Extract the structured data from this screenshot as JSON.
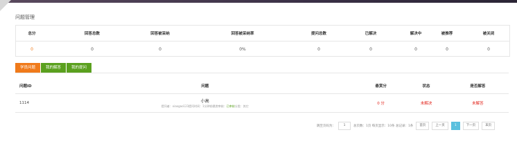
{
  "section_title": "问题管理",
  "stats": {
    "headers": [
      "总分",
      "回答总数",
      "回答被采纳",
      "回答被采纳率",
      "提问总数",
      "已解决",
      "解决中",
      "被推荐",
      "被关闭"
    ],
    "values": [
      "0",
      "0",
      "0",
      "0%",
      "0",
      "0",
      "0",
      "0",
      "0"
    ]
  },
  "tabs": [
    {
      "label": "学员问题",
      "active": true
    },
    {
      "label": "我的解答",
      "active": false
    },
    {
      "label": "我的提问",
      "active": false
    }
  ],
  "table": {
    "headers": {
      "id": "问题ID",
      "title": "问题",
      "reward": "悬赏分",
      "status": "状态",
      "accepted": "是否解答"
    },
    "rows": [
      {
        "id": "1114",
        "title": "小高",
        "meta_prefix": "提问者：xiaogao123提问时间：1分钟前悬赏审核：",
        "meta_status": "已审核",
        "meta_suffix": "分类：其它",
        "reward": "0 分",
        "status": "未解决",
        "accepted": "未解答"
      }
    ]
  },
  "pager": {
    "jump_label": "跳至页码为：",
    "jump_value": "1",
    "summary": "总页数：1页 每页显示：10条 总记录：1条",
    "first": "首页",
    "prev": "上一页",
    "current": "1",
    "next": "下一页",
    "last": "末页"
  },
  "colors": {
    "accent_orange": "#f07a1a",
    "accent_green": "#5aa01e",
    "red": "#e2231a",
    "pager_current": "#5bc0de"
  }
}
